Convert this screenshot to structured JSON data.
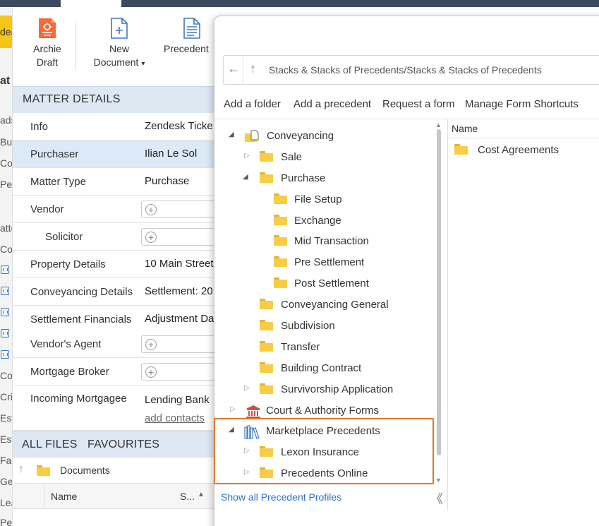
{
  "left_strip": {
    "yellow_button": "dea",
    "fragments": [
      "ads",
      "Bu",
      "Co",
      "Pe",
      "atte",
      "Co",
      "Co",
      "Cri",
      "Est",
      "Est",
      "Far",
      "Ge",
      "Lea",
      "Pe"
    ],
    "heading_fragment": "at"
  },
  "ribbon": {
    "archie_draft_line1": "Archie",
    "archie_draft_line2": "Draft",
    "new_document_line1": "New",
    "new_document_line2": "Document",
    "new_document_caret": "▾",
    "precedent": "Precedent"
  },
  "matter_details": {
    "title": "MATTER DETAILS",
    "rows": [
      {
        "label": "Info",
        "value": "Zendesk Ticke"
      },
      {
        "label": "Purchaser",
        "value": "Ilian Le Sol"
      },
      {
        "label": "Matter Type",
        "value": "Purchase"
      },
      {
        "label": "Vendor",
        "value": ""
      },
      {
        "label": "Solicitor",
        "value": ""
      },
      {
        "label": "Property Details",
        "value": "10 Main Street"
      },
      {
        "label": "Conveyancing Details",
        "value": "Settlement: 20"
      },
      {
        "label": "Settlement Financials",
        "value": "Adjustment Da"
      },
      {
        "label": "Vendor's Agent",
        "value": ""
      },
      {
        "label": "Mortgage Broker",
        "value": ""
      },
      {
        "label": "Incoming Mortgagee",
        "value": "Lending Bank"
      }
    ],
    "add_contacts": "add contacts"
  },
  "files": {
    "tab_all": "ALL FILES",
    "tab_fav": "FAVOURITES",
    "folder": "Documents",
    "col_name": "Name",
    "col_size": "S..."
  },
  "dialog": {
    "path": "Stacks & Stacks of Precedents/Stacks & Stacks of Precedents",
    "commands": [
      "Add a folder",
      "Add a precedent",
      "Request a form",
      "Manage Form Shortcuts"
    ],
    "tree": [
      {
        "label": "Conveyancing"
      },
      {
        "label": "Sale"
      },
      {
        "label": "Purchase"
      },
      {
        "label": "File Setup"
      },
      {
        "label": "Exchange"
      },
      {
        "label": "Mid Transaction"
      },
      {
        "label": "Pre Settlement"
      },
      {
        "label": "Post Settlement"
      },
      {
        "label": "Conveyancing General"
      },
      {
        "label": "Subdivision"
      },
      {
        "label": "Transfer"
      },
      {
        "label": "Building Contract"
      },
      {
        "label": "Survivorship Application"
      },
      {
        "label": "Court & Authority Forms"
      },
      {
        "label": "Marketplace Precedents"
      },
      {
        "label": "Lexon Insurance"
      },
      {
        "label": "Precedents Online"
      }
    ],
    "list_header": "Name",
    "list_items": [
      "Cost Agreements"
    ],
    "footer_link": "Show all Precedent Profiles",
    "collapse_glyph": "《"
  },
  "colors": {
    "accent": "#2a72c6",
    "highlight": "#e0782e",
    "folder": "#f7cd45",
    "panel_header": "#dde8f3"
  }
}
